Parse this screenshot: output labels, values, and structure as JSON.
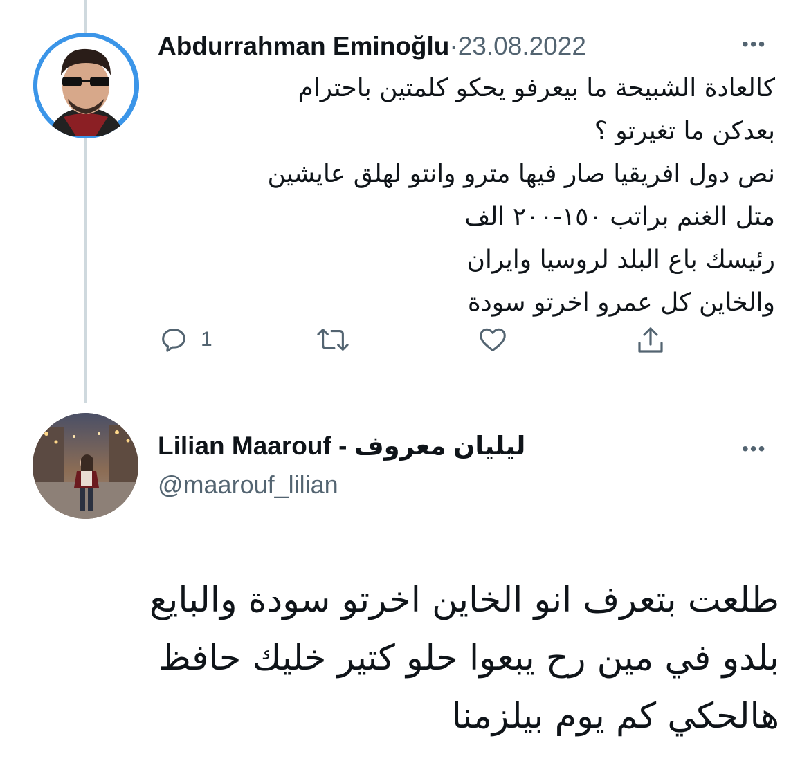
{
  "tweet1": {
    "author_name": "Abdurrahman Eminoğlu",
    "separator": " · ",
    "date": "23.08.2022",
    "more_label": "•••",
    "body_lines": [
      "كالعادة الشبيحة ما بيعرفو يحكو كلمتين باحترام",
      "بعدكن ما تغيرتو ؟",
      "نص دول افريقيا صار فيها مترو وانتو لهلق عايشين",
      "متل الغنم براتب ١٥٠-٢٠٠ الف",
      "رئيسك باع البلد لروسيا وايران",
      "والخاين كل عمرو اخرتو سودة"
    ],
    "actions": {
      "reply_count": "1"
    }
  },
  "tweet2": {
    "author_name": "Lilian Maarouf - ليليان معروف",
    "handle": "@maarouf_lilian",
    "more_label": "•••",
    "body_lines": [
      "طلعت بتعرف انو الخاين اخرتو سودة والبايع",
      "بلدو في مين رح يبعوا حلو كتير خليك حافظ",
      "هالحكي كم يوم بيلزمنا"
    ]
  },
  "colors": {
    "text_primary": "#0f1419",
    "text_secondary": "#536471",
    "thread_line": "#cfd9de",
    "avatar1_bg": "#3b95e8"
  },
  "icons": [
    "reply-icon",
    "retweet-icon",
    "like-icon",
    "share-icon",
    "more-icon"
  ]
}
